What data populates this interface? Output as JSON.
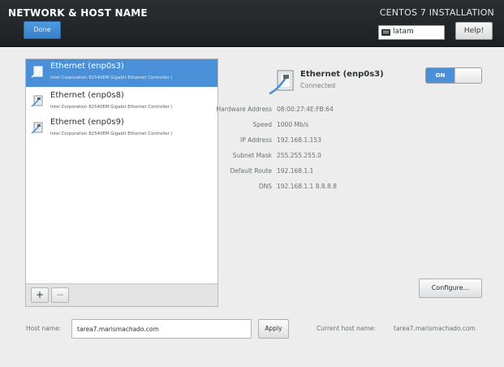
{
  "header": {
    "title": "NETWORK & HOST NAME",
    "done_label": "Done",
    "install_title": "CENTOS 7 INSTALLATION",
    "keyboard_layout": "latam",
    "help_label": "Help!"
  },
  "devices": [
    {
      "name": "Ethernet (enp0s3)",
      "description": "Intel Corporation 82540EM Gigabit Ethernet Controller (",
      "selected": true
    },
    {
      "name": "Ethernet (enp0s8)",
      "description": "Intel Corporation 82540EM Gigabit Ethernet Controller (",
      "selected": false
    },
    {
      "name": "Ethernet (enp0s9)",
      "description": "Intel Corporation 82540EM Gigabit Ethernet Controller (",
      "selected": false
    }
  ],
  "list_buttons": {
    "add": "+",
    "remove": "−"
  },
  "detail": {
    "name": "Ethernet (enp0s3)",
    "status": "Connected",
    "toggle_label": "ON",
    "properties": [
      {
        "label": "Hardware Address",
        "value": "08:00:27:4E:FB:64"
      },
      {
        "label": "Speed",
        "value": "1000 Mb/s"
      },
      {
        "label": "IP Address",
        "value": "192.168.1.153"
      },
      {
        "label": "Subnet Mask",
        "value": "255.255.255.0"
      },
      {
        "label": "Default Route",
        "value": "192.168.1.1"
      },
      {
        "label": "DNS",
        "value": "192.168.1.1 8.8.8.8"
      }
    ],
    "configure_label": "Configure..."
  },
  "hostname": {
    "label": "Host name:",
    "value": "tarea7.marismachado.com",
    "apply_label": "Apply",
    "current_label": "Current host name:",
    "current_value": "tarea7.marismachado.com"
  },
  "colors": {
    "accent": "#4a90d9",
    "header_bg": "#1d2123",
    "background": "#ededed"
  }
}
